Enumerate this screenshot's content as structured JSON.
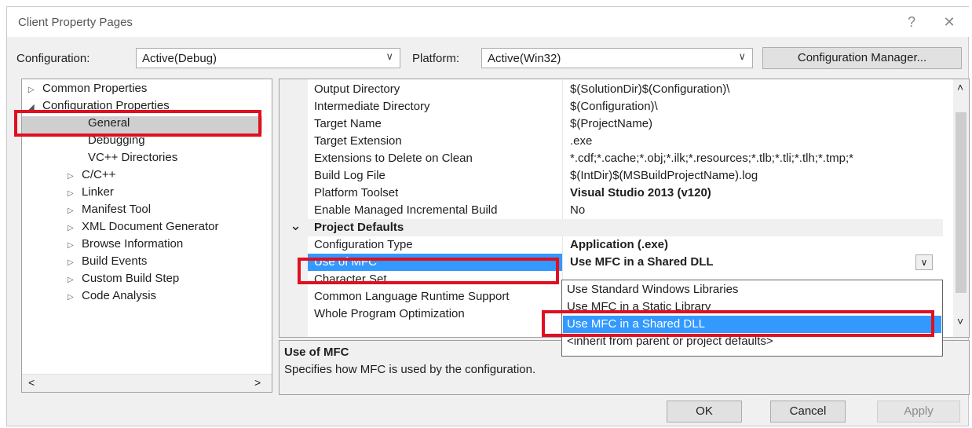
{
  "window": {
    "title": "Client Property Pages",
    "help_glyph": "?",
    "close_glyph": "✕"
  },
  "toolbar": {
    "configuration_label": "Configuration:",
    "configuration_value": "Active(Debug)",
    "platform_label": "Platform:",
    "platform_value": "Active(Win32)",
    "config_manager_label": "Configuration Manager..."
  },
  "tree": {
    "items": [
      {
        "label": "Common Properties",
        "expander": "▷"
      },
      {
        "label": "Configuration Properties",
        "expander": "◢"
      },
      {
        "label": "General",
        "expander": ""
      },
      {
        "label": "Debugging",
        "expander": ""
      },
      {
        "label": "VC++ Directories",
        "expander": ""
      },
      {
        "label": "C/C++",
        "expander": "▷"
      },
      {
        "label": "Linker",
        "expander": "▷"
      },
      {
        "label": "Manifest Tool",
        "expander": "▷"
      },
      {
        "label": "XML Document Generator",
        "expander": "▷"
      },
      {
        "label": "Browse Information",
        "expander": "▷"
      },
      {
        "label": "Build Events",
        "expander": "▷"
      },
      {
        "label": "Custom Build Step",
        "expander": "▷"
      },
      {
        "label": "Code Analysis",
        "expander": "▷"
      }
    ],
    "scroll_left": "<",
    "scroll_right": ">"
  },
  "grid": {
    "rows": [
      {
        "name": "Output Directory",
        "value": "$(SolutionDir)$(Configuration)\\"
      },
      {
        "name": "Intermediate Directory",
        "value": "$(Configuration)\\"
      },
      {
        "name": "Target Name",
        "value": "$(ProjectName)"
      },
      {
        "name": "Target Extension",
        "value": ".exe"
      },
      {
        "name": "Extensions to Delete on Clean",
        "value": "*.cdf;*.cache;*.obj;*.ilk;*.resources;*.tlb;*.tli;*.tlh;*.tmp;*"
      },
      {
        "name": "Build Log File",
        "value": "$(IntDir)$(MSBuildProjectName).log"
      },
      {
        "name": "Platform Toolset",
        "value": "Visual Studio 2013 (v120)"
      },
      {
        "name": "Enable Managed Incremental Build",
        "value": "No"
      }
    ],
    "section": {
      "label": "Project Defaults",
      "chevron": "⌄"
    },
    "rows2": [
      {
        "name": "Configuration Type",
        "value": "Application (.exe)"
      },
      {
        "name": "Use of MFC",
        "value": "Use MFC in a Shared DLL"
      },
      {
        "name": "Character Set",
        "value": ""
      },
      {
        "name": "Common Language Runtime Support",
        "value": ""
      },
      {
        "name": "Whole Program Optimization",
        "value": ""
      }
    ],
    "scroll_up": "˄",
    "scroll_down": "˅"
  },
  "dropdown": {
    "options": [
      "Use Standard Windows Libraries",
      "Use MFC in a Static Library",
      "Use MFC in a Shared DLL",
      "<inherit from parent or project defaults>"
    ]
  },
  "description": {
    "title": "Use of MFC",
    "text": "Specifies how MFC is used by the configuration."
  },
  "buttons": {
    "ok": "OK",
    "cancel": "Cancel",
    "apply": "Apply"
  },
  "colors": {
    "selection": "#3399ff",
    "highlight_box": "#e01020"
  }
}
